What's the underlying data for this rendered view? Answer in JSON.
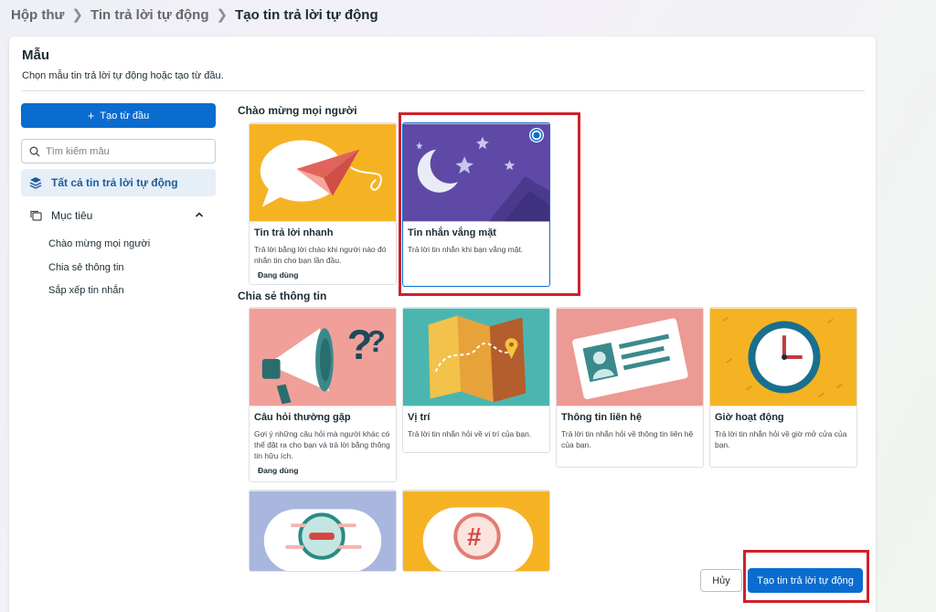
{
  "breadcrumb": {
    "items": [
      "Hộp thư",
      "Tin trả lời tự động",
      "Tạo tin trả lời tự động"
    ]
  },
  "panel": {
    "title": "Mẫu",
    "subtitle": "Chọn mẫu tin trả lời tự động hoặc tạo từ đầu."
  },
  "sidebar": {
    "create_label": "Tạo từ đầu",
    "search_placeholder": "Tìm kiếm mẫu",
    "all_label": "Tất cả tin trả lời tự động",
    "goal_label": "Mục tiêu",
    "sub_items": [
      "Chào mừng mọi người",
      "Chia sẻ thông tin",
      "Sắp xếp tin nhắn"
    ]
  },
  "sections": {
    "welcome": "Chào mừng mọi người",
    "share": "Chia sẻ thông tin"
  },
  "cards": [
    {
      "title": "Tin trả lời nhanh",
      "desc": "Trả lời bằng lời chào khi người nào đó nhắn tin cho bạn lần đầu.",
      "badge": "Đang dùng"
    },
    {
      "title": "Tin nhắn vắng mặt",
      "desc": "Trả lời tin nhắn khi bạn vắng mặt.",
      "badge": ""
    },
    {
      "title": "Câu hỏi thường gặp",
      "desc": "Gợi ý những câu hỏi mà người khác có thể đặt ra cho bạn và trả lời bằng thông tin hữu ích.",
      "badge": "Đang dùng"
    },
    {
      "title": "Vị trí",
      "desc": "Trả lời tin nhắn hỏi về vị trí của bạn.",
      "badge": ""
    },
    {
      "title": "Thông tin liên hệ",
      "desc": "Trả lời tin nhắn hỏi về thông tin liên hệ của bạn.",
      "badge": ""
    },
    {
      "title": "Giờ hoạt động",
      "desc": "Trả lời tin nhắn hỏi về giờ mở cửa của bạn.",
      "badge": ""
    }
  ],
  "footer": {
    "cancel_label": "Hủy",
    "create_label": "Tạo tin trả lời tự động"
  },
  "colors": {
    "primary": "#0a6ccf",
    "highlight": "#d0202a",
    "selected_nav_bg": "#e6eef8"
  }
}
